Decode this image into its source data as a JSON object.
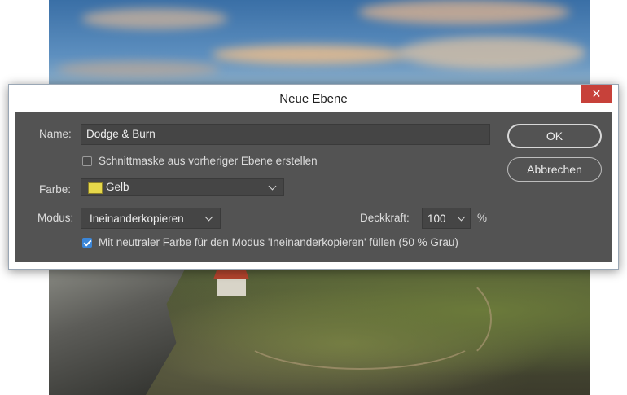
{
  "dialog": {
    "title": "Neue Ebene",
    "close_icon": "close-icon",
    "name_label": "Name:",
    "name_value": "Dodge & Burn",
    "clip_mask_label": "Schnittmaske aus vorheriger Ebene erstellen",
    "clip_mask_checked": false,
    "color_label": "Farbe:",
    "color_value": "Gelb",
    "color_swatch": "#e6d84a",
    "mode_label": "Modus:",
    "mode_value": "Ineinanderkopieren",
    "opacity_label": "Deckkraft:",
    "opacity_value": "100",
    "opacity_unit": "%",
    "fill_neutral_label": "Mit neutraler Farbe für den Modus 'Ineinanderkopieren' füllen (50 % Grau)",
    "fill_neutral_checked": true,
    "ok_label": "OK",
    "cancel_label": "Abbrechen"
  },
  "colors": {
    "client_bg": "#535353",
    "close_button": "#c7413a",
    "checkbox_checked": "#3b86d8"
  }
}
